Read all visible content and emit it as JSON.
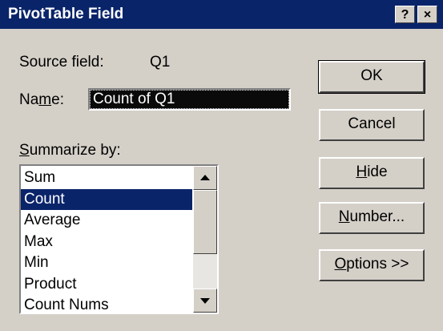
{
  "window": {
    "title": "PivotTable Field",
    "help_button": "?",
    "close_button": "×"
  },
  "source_field": {
    "label": "Source field:",
    "value": "Q1"
  },
  "name": {
    "label_pre": "Na",
    "label_u": "m",
    "label_post": "e:",
    "value": "Count of Q1"
  },
  "summarize": {
    "label_u": "S",
    "label_post": "ummarize by:",
    "items": [
      "Sum",
      "Count",
      "Average",
      "Max",
      "Min",
      "Product",
      "Count Nums"
    ],
    "selected": "Count"
  },
  "buttons": {
    "ok": "OK",
    "cancel": "Cancel",
    "hide": {
      "u": "H",
      "post": "ide"
    },
    "number": {
      "u": "N",
      "post": "umber..."
    },
    "options": {
      "u": "O",
      "post": "ptions >>"
    }
  },
  "colors": {
    "title_bar": "#0a246a",
    "face": "#d4d0c8",
    "selection": "#0a246a"
  }
}
